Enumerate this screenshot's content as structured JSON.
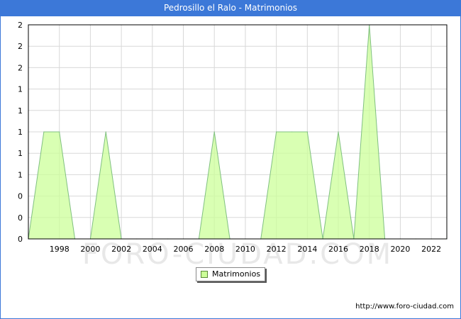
{
  "title": "Pedrosillo el Ralo - Matrimonios",
  "legend": {
    "label": "Matrimonios"
  },
  "footer": {
    "url": "http://www.foro-ciudad.com"
  },
  "watermark": "FORO-CIUDAD.COM",
  "colors": {
    "fill": "#ccff99",
    "line": "#80c080",
    "header": "#3c78d8"
  },
  "chart_data": {
    "type": "area",
    "title": "Pedrosillo el Ralo - Matrimonios",
    "xlabel": "",
    "ylabel": "",
    "x": [
      1996,
      1997,
      1998,
      1999,
      2000,
      2001,
      2002,
      2003,
      2004,
      2005,
      2006,
      2007,
      2008,
      2009,
      2010,
      2011,
      2012,
      2013,
      2014,
      2015,
      2016,
      2017,
      2018,
      2019,
      2020,
      2021,
      2022,
      2023
    ],
    "series": [
      {
        "name": "Matrimonios",
        "values": [
          0,
          1,
          1,
          0,
          0,
          1,
          0,
          0,
          0,
          0,
          0,
          0,
          1,
          0,
          0,
          0,
          1,
          1,
          1,
          0,
          1,
          0,
          2,
          0,
          0,
          0,
          0,
          0
        ]
      }
    ],
    "xlim": [
      1996,
      2023
    ],
    "ylim": [
      0,
      2
    ],
    "x_ticks": [
      1998,
      2000,
      2002,
      2004,
      2006,
      2008,
      2010,
      2012,
      2014,
      2016,
      2018,
      2020,
      2022
    ],
    "y_ticks": [
      0,
      0.2,
      0.4,
      0.6,
      0.8,
      1.0,
      1.2,
      1.4,
      1.6,
      1.8,
      2.0
    ],
    "y_tick_labels": [
      "0",
      "0",
      "0",
      "1",
      "1",
      "1",
      "1",
      "1",
      "2",
      "2",
      "2"
    ],
    "grid": true,
    "legend_position": "bottom-center"
  }
}
